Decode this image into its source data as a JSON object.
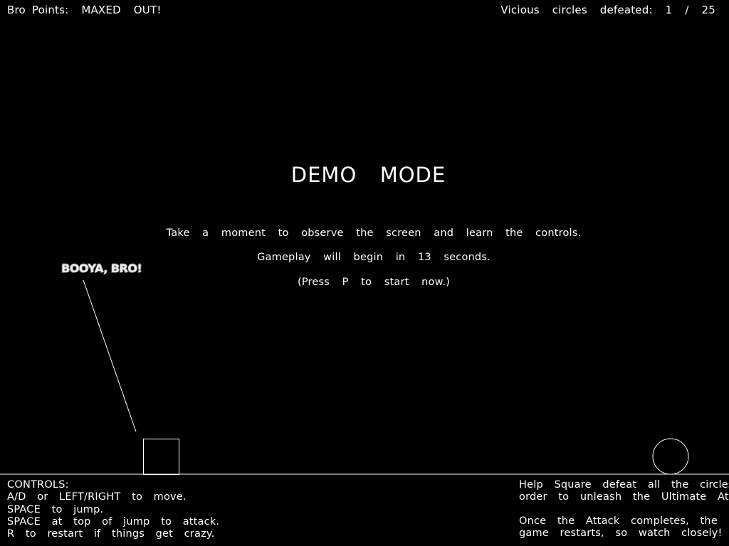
{
  "hud": {
    "bro_points": "Bro Points:  MAXED  OUT!",
    "circles_defeated": "Vicious  circles  defeated:  1  /  25"
  },
  "title": "DEMO  MODE",
  "messages": {
    "observe": "Take  a  moment  to  observe  the  screen  and  learn  the  controls.",
    "countdown": "Gameplay  will  begin  in  13  seconds.",
    "press_p": "(Press  P  to  start  now.)"
  },
  "shout": "BOOYA, BRO!",
  "controls": {
    "header": "CONTROLS:",
    "lines": [
      "A/D  or  LEFT/RIGHT  to  move.",
      "SPACE  to  jump.",
      "SPACE  at  top  of  jump  to  attack.",
      "R  to  restart  if  things  get  crazy."
    ]
  },
  "help": {
    "lines": [
      "Help  Square  defeat  all  the  circles  in",
      "order  to  unleash  the  Ultimate  Attack."
    ],
    "lines2": [
      "Once  the  Attack  completes,  the",
      "game  restarts,  so  watch  closely!"
    ]
  },
  "colors": {
    "background": "#000000",
    "foreground": "#ffffff"
  }
}
